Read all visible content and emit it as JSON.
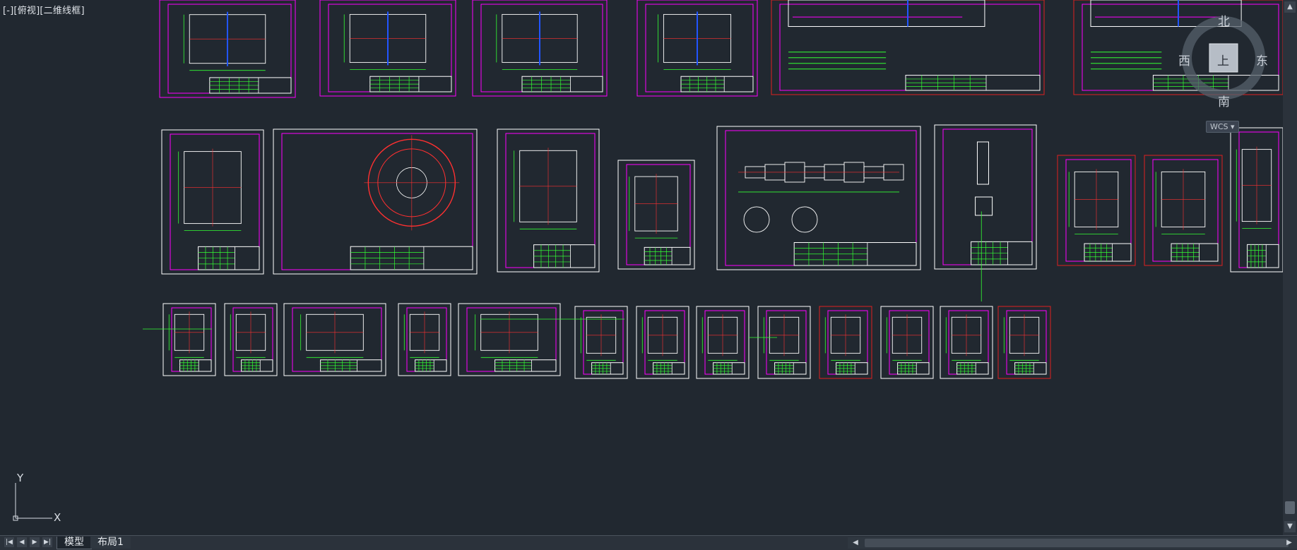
{
  "viewport": {
    "view_label": "[-][俯视][二维线框]"
  },
  "navcube": {
    "north": "北",
    "south": "南",
    "east": "东",
    "west": "西",
    "face": "上",
    "wcs": "WCS"
  },
  "ucs": {
    "x": "X",
    "y": "Y"
  },
  "layout_tabs": [
    {
      "label": "模型",
      "active": true
    },
    {
      "label": "布局1",
      "active": false
    }
  ],
  "colors": {
    "background": "#212830",
    "sheet_border": "#ffffff",
    "drawing_frame": "#ff00ff",
    "red_frame": "#e02020",
    "geometry": "#33ff33",
    "center_lines": "#ff3030",
    "dim_text": "#66ff66",
    "blue_accent": "#2255ff"
  },
  "icons": {
    "first": "first-sheet-icon",
    "prev": "prev-sheet-icon",
    "next": "next-sheet-icon",
    "last": "last-sheet-icon"
  }
}
